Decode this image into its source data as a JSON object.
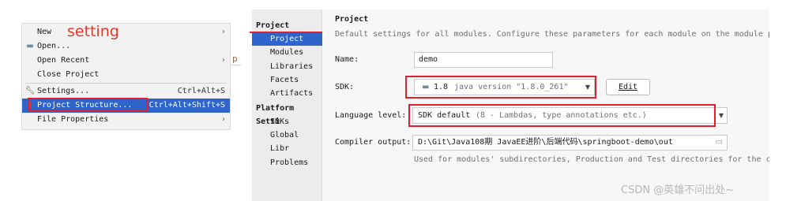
{
  "menu": {
    "items": [
      {
        "label": "New",
        "shortcut": "",
        "submenu": true
      },
      {
        "label": "Open...",
        "shortcut": "",
        "submenu": false
      },
      {
        "label": "Open Recent",
        "shortcut": "",
        "submenu": true
      },
      {
        "label": "Close Project",
        "shortcut": "",
        "submenu": false
      },
      {
        "label": "Settings...",
        "shortcut": "Ctrl+Alt+S",
        "submenu": false
      },
      {
        "label": "Project Structure...",
        "shortcut": "Ctrl+Alt+Shift+S",
        "submenu": false
      },
      {
        "label": "File Properties",
        "shortcut": "",
        "submenu": true
      }
    ],
    "annotation": "setting",
    "edge_char": "p"
  },
  "sidebar": {
    "project_settings_header": "Project Settin",
    "project_items": [
      "Project",
      "Modules",
      "Libraries",
      "Facets",
      "Artifacts"
    ],
    "platform_settings_header": "Platform Setti",
    "platform_items": [
      "SDKs",
      "Global Libr"
    ],
    "problems": "Problems"
  },
  "project": {
    "title": "Project",
    "description": "Default settings for all modules. Configure these parameters for each module on the module p",
    "name_label": "Name:",
    "name_value": "demo",
    "sdk_label": "SDK:",
    "sdk_value": "1.8",
    "sdk_detail": "java version \"1.8.0_261\"",
    "edit_button": "Edit",
    "language_label": "Language level:",
    "language_value": "SDK default",
    "language_detail": "(8 - Lambdas, type annotations etc.)",
    "compiler_label": "Compiler output:",
    "compiler_value": "D:\\Git\\Java108期 JavaEE进阶\\后端代码\\springboot-demo\\out",
    "compiler_hint": "Used for modules' subdirectories, Production and Test directories for the c"
  },
  "watermark": "CSDN @英雄不问出处~",
  "colors": {
    "selection": "#2f65ca",
    "annotation_red": "#e0202e"
  }
}
